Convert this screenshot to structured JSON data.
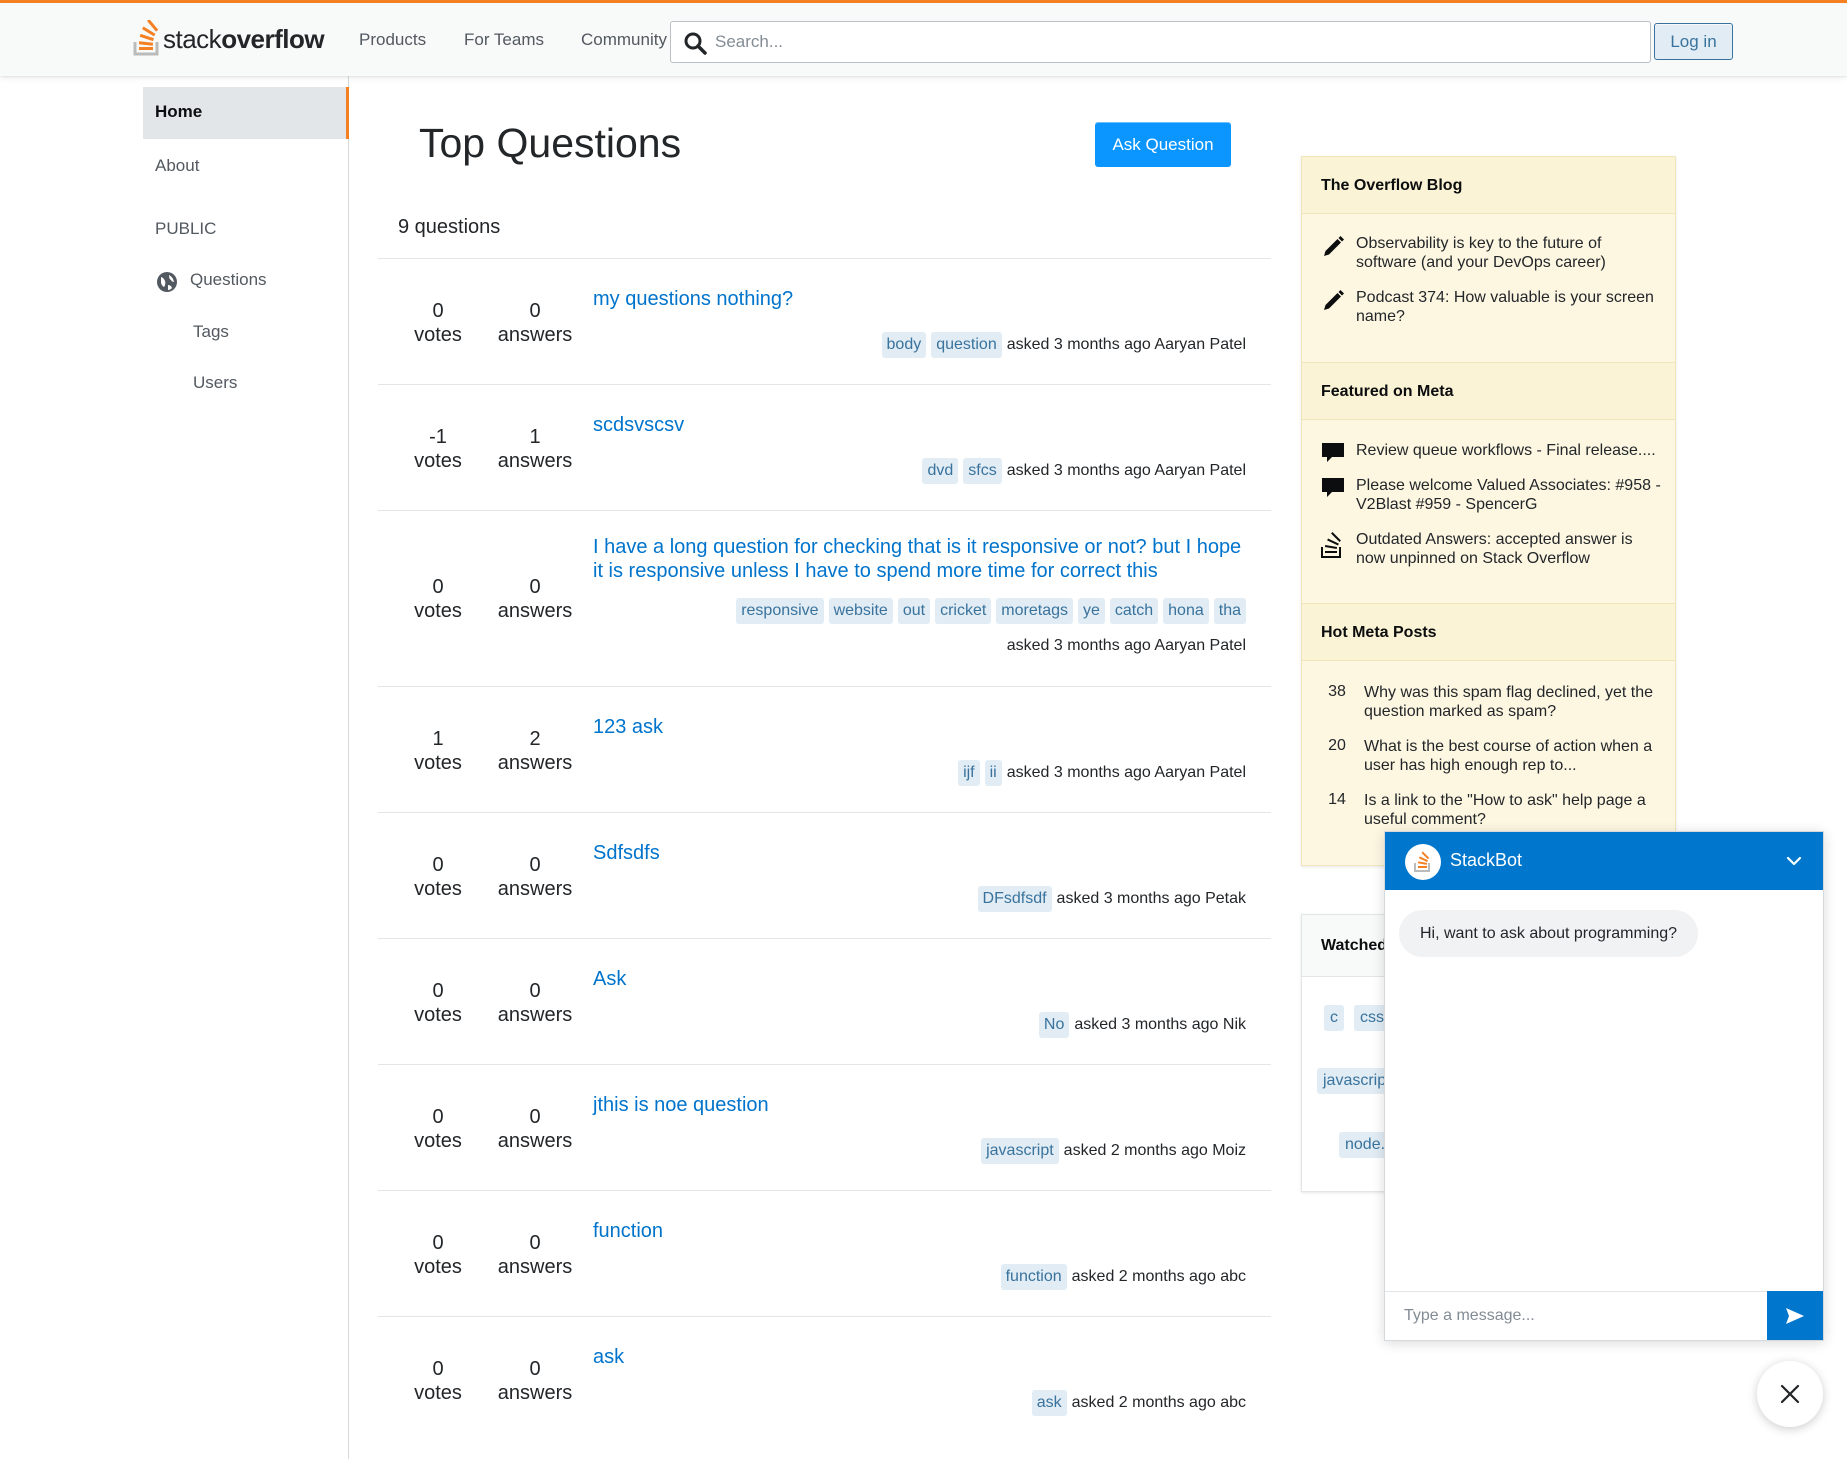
{
  "header": {
    "logo_text_light": "stack",
    "logo_text_bold": "overflow",
    "nav": [
      "Products",
      "For Teams",
      "Community"
    ],
    "search_placeholder": "Search...",
    "login_label": "Log in",
    "accent_color": "#f48024"
  },
  "leftnav": {
    "home": "Home",
    "about": "About",
    "public_heading": "PUBLIC",
    "questions": "Questions",
    "tags": "Tags",
    "users": "Users"
  },
  "main": {
    "title": "Top Questions",
    "ask_button": "Ask Question",
    "count_label": "9 questions",
    "questions": [
      {
        "votes": "0",
        "answers": "0",
        "title": "my questions nothing?",
        "tags": [
          "body",
          "question"
        ],
        "asked": "asked 3 months ago Aaryan Patel"
      },
      {
        "votes": "-1",
        "answers": "1",
        "title": "scdsvscsv",
        "tags": [
          "dvd",
          "sfcs"
        ],
        "asked": "asked 3 months ago Aaryan Patel"
      },
      {
        "votes": "0",
        "answers": "0",
        "title": "I have a long question for checking that is it responsive or not? but I hope it is responsive unless I have to spend more time for correct this",
        "tags": [
          "responsive",
          "website",
          "out",
          "cricket",
          "moretags",
          "ye",
          "catch",
          "hona",
          "tha"
        ],
        "asked": "asked 3 months ago Aaryan Patel"
      },
      {
        "votes": "1",
        "answers": "2",
        "title": "123 ask",
        "tags": [
          "ijf",
          "ii"
        ],
        "asked": "asked 3 months ago Aaryan Patel"
      },
      {
        "votes": "0",
        "answers": "0",
        "title": "Sdfsdfs",
        "tags": [
          "DFsdfsdf"
        ],
        "asked": "asked 3 months ago Petak"
      },
      {
        "votes": "0",
        "answers": "0",
        "title": "Ask",
        "tags": [
          "No"
        ],
        "asked": "asked 3 months ago Nik"
      },
      {
        "votes": "0",
        "answers": "0",
        "title": "jthis is noe question",
        "tags": [
          "javascript"
        ],
        "asked": "asked 2 months ago Moiz"
      },
      {
        "votes": "0",
        "answers": "0",
        "title": "function",
        "tags": [
          "function"
        ],
        "asked": "asked 2 months ago abc"
      },
      {
        "votes": "0",
        "answers": "0",
        "title": "ask",
        "tags": [
          "ask"
        ],
        "asked": "asked 2 months ago abc"
      }
    ],
    "votes_label": "votes",
    "answers_label": "answers"
  },
  "sidebar": {
    "blog_heading": "The Overflow Blog",
    "blog_items": [
      "Observability is key to the future of software (and your DevOps career)",
      "Podcast 374: How valuable is your screen name?"
    ],
    "meta_heading": "Featured on Meta",
    "meta_items": [
      "Review queue workflows - Final release....",
      "Please welcome Valued Associates: #958 - V2Blast #959 - SpencerG",
      "Outdated Answers: accepted answer is now unpinned on Stack Overflow"
    ],
    "hot_heading": "Hot Meta Posts",
    "hot_items": [
      {
        "count": "38",
        "text": "Why was this spam flag declined, yet the question marked as spam?"
      },
      {
        "count": "20",
        "text": "What is the best course of action when a user has high enough rep to..."
      },
      {
        "count": "14",
        "text": "Is a link to the \"How to ask\" help page a useful comment?"
      }
    ],
    "watched_heading": "Watched",
    "watched_tags": [
      "c",
      "css",
      "javascrip",
      "node."
    ]
  },
  "chatbot": {
    "name": "StackBot",
    "greeting": "Hi, want to ask about programming?",
    "input_placeholder": "Type a message...",
    "brand_color": "#0077cc"
  }
}
